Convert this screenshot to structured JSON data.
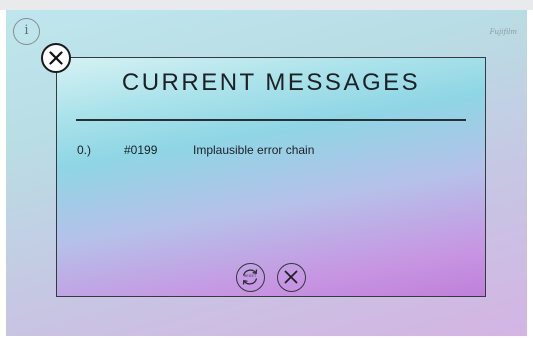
{
  "brand": {
    "label": "Fujifilm"
  },
  "info_button": {
    "label": "i"
  },
  "dialog": {
    "title": "CURRENT MESSAGES",
    "messages": [
      {
        "index": "0.)",
        "code": "#0199",
        "text": "Implausible error chain"
      }
    ],
    "reset_button": {
      "label": "RESET"
    }
  },
  "icons": {
    "corner_close": "close-icon",
    "reset": "refresh-icon",
    "close": "close-icon"
  },
  "colors": {
    "dialog_border": "#333a40",
    "title_text": "#1b2126"
  }
}
